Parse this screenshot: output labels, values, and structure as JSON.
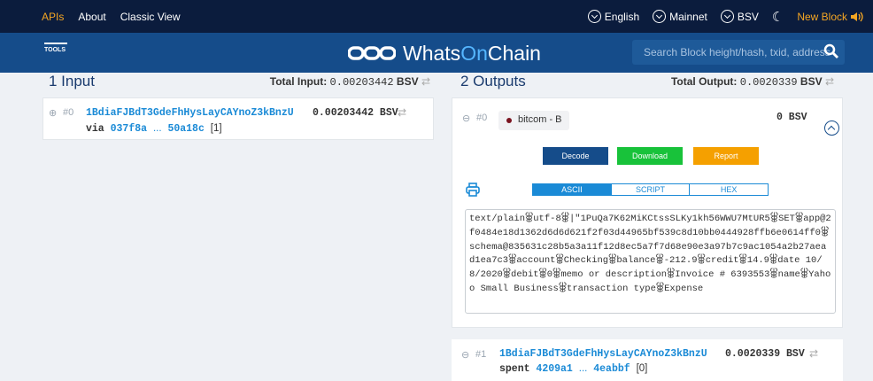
{
  "topbar": {
    "links": [
      "APIs",
      "About",
      "Classic View"
    ],
    "language": "English",
    "network": "Mainnet",
    "coin": "BSV",
    "new_block": "New Block"
  },
  "nav": {
    "tools_label": "TOOLS",
    "brand_whats": "Whats",
    "brand_on": "On",
    "brand_chain": "Chain",
    "search_placeholder": "Search Block height/hash, txid, address"
  },
  "inputs": {
    "title": "1 Input",
    "total_label": "Total Input:",
    "total_value": "0.00203442",
    "unit": "BSV",
    "items": [
      {
        "index": "#0",
        "address": "1BdiaFJBdT3GdeFhHysLayCAYnoZ3kBnzU",
        "amount": "0.00203442 BSV",
        "via_label": "via",
        "hash_start": "037f8a",
        "dots": "...",
        "hash_end": "50a18c",
        "vout": "[1]"
      }
    ]
  },
  "outputs": {
    "title": "2 Outputs",
    "total_label": "Total Output:",
    "total_value": "0.0020339",
    "unit": "BSV",
    "items": [
      {
        "index": "#0",
        "tag": "bitcom - B",
        "amount": "0 BSV",
        "buttons": {
          "decode": "Decode",
          "download": "Download",
          "report": "Report"
        },
        "tabs": [
          "ASCII",
          "SCRIPT",
          "HEX"
        ],
        "raw": "text/plain⯚utf-8⯚|\"1PuQa7K62MiKCtssSLKy1kh56WWU7MtUR5⯚SET⯚app@2f0484e18d1362d6d6d621f2f03d44965bf539c8d10bb0444928ffb6e0614ff0⯚schema@835631c28b5a3a11f12d8ec5a7f7d68e90e3a97b7c9ac1054a2b27aead1ea7c3⯚account⯚Checking⯚balance⯚-212.9⯚credit⯚14.9⯚date 10/8/2020⯚debit⯚0⯚memo or description⯚Invoice # 6393553⯚name⯚Yahoo Small Business⯚transaction type⯚Expense"
      },
      {
        "index": "#1",
        "address": "1BdiaFJBdT3GdeFhHysLayCAYnoZ3kBnzU",
        "amount": "0.0020339 BSV",
        "spent_label": "spent",
        "hash_start": "4209a1",
        "dots": "...",
        "hash_end": "4eabbf",
        "vout": "[0]"
      }
    ]
  },
  "colors": {
    "topbar_bg": "#0b1c3d",
    "nav_bg": "#154c8a",
    "accent": "#f5a623",
    "link": "#1a8ad6",
    "decode": "#154c8a",
    "download": "#18c23a",
    "report": "#f5a000"
  }
}
